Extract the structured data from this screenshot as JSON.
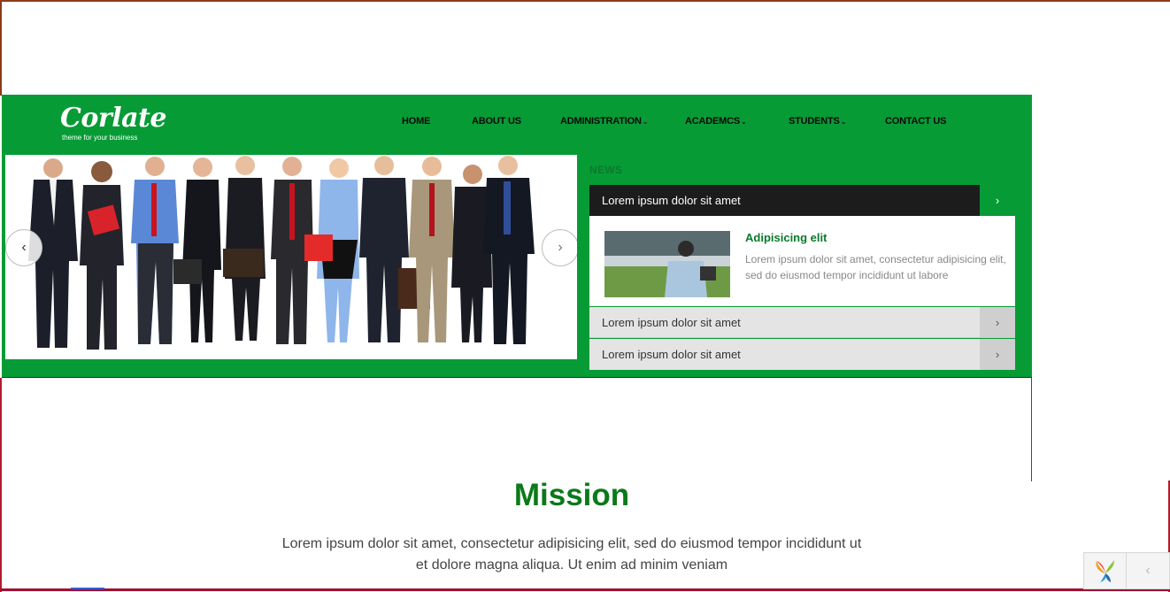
{
  "brand": {
    "name": "Corlate",
    "tagline": "theme for your business"
  },
  "nav": {
    "items": [
      {
        "label": "HOME",
        "caret": ""
      },
      {
        "label": "ABOUT US",
        "caret": ""
      },
      {
        "label": "ADMINISTRATION",
        "caret": "⌄"
      },
      {
        "label": "ACADEMCS",
        "caret": "⌄"
      },
      {
        "label": "STUDENTS",
        "caret": "⌄"
      },
      {
        "label": "CONTACT US",
        "caret": ""
      }
    ]
  },
  "slider": {
    "prev_icon": "‹",
    "next_icon": "›"
  },
  "news": {
    "heading": "NEWS",
    "items": [
      {
        "label": "Lorem ipsum dolor sit amet",
        "arrow": "›"
      },
      {
        "label": "Lorem ipsum dolor sit amet",
        "arrow": "›"
      },
      {
        "label": "Lorem ipsum dolor sit amet",
        "arrow": "›"
      }
    ],
    "card": {
      "title": "Adipisicing elit",
      "text": "Lorem ipsum dolor sit amet, consectetur adipisicing elit, sed do eiusmod tempor incididunt ut labore"
    }
  },
  "mission": {
    "title": "Mission",
    "text": "Lorem ipsum dolor sit amet, consectetur adipisicing elit, sed do eiusmod tempor incididunt ut et dolore magna aliqua. Ut enim ad minim veniam"
  },
  "widget": {
    "arrow": "‹"
  },
  "colors": {
    "brand_green": "#079b36",
    "title_green": "#0a7a1a",
    "dark": "#1c1c1c"
  }
}
